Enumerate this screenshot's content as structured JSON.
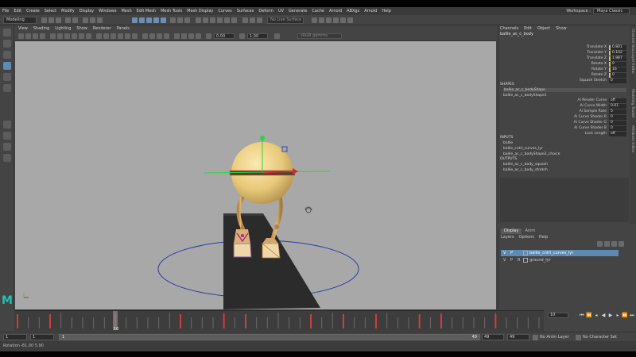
{
  "menubar": {
    "items": [
      "File",
      "Edit",
      "Create",
      "Select",
      "Modify",
      "Display",
      "Windows",
      "Mesh",
      "Edit Mesh",
      "Mesh Tools",
      "Mesh Display",
      "Curves",
      "Surfaces",
      "Deform",
      "UV",
      "Generate",
      "Cache",
      "Arnold",
      "ABXgs",
      "Arnold",
      "Help"
    ],
    "workspace_label": "Workspace :",
    "workspace_value": "Maya Classic"
  },
  "statusline": {
    "mode": "Modeling",
    "live_surface": "No Live Surface"
  },
  "viewport": {
    "menu": [
      "View",
      "Shading",
      "Lighting",
      "Show",
      "Renderer",
      "Panels"
    ],
    "field_a": "0.00",
    "field_b": "1.00",
    "color_space": "sRGB gamma"
  },
  "channel_box": {
    "menu": [
      "Channels",
      "Edit",
      "Object",
      "Show"
    ],
    "object": "ballie_ac_c_body",
    "attrs": [
      {
        "name": "Translate X",
        "value": "0.801"
      },
      {
        "name": "Translate Y",
        "value": "0.102"
      },
      {
        "name": "Translate Z",
        "value": "1.987"
      },
      {
        "name": "Rotate X",
        "value": "0"
      },
      {
        "name": "Rotate Y",
        "value": "16"
      },
      {
        "name": "Rotate Z",
        "value": "0"
      },
      {
        "name": "Squash Stretch",
        "value": "0"
      }
    ],
    "shapes_label": "SHAPES",
    "shapes": [
      "ballie_ac_c_bodyShape",
      "ballie_ac_c_bodyShape1"
    ],
    "shape_attrs": [
      {
        "name": "Ai Render Curve",
        "value": "off"
      },
      {
        "name": "Ai Curve Width",
        "value": "0.01"
      },
      {
        "name": "Ai Sample Rate",
        "value": "5"
      },
      {
        "name": "Ai Curve Shader R",
        "value": "0"
      },
      {
        "name": "Ai Curve Shader G",
        "value": "0"
      },
      {
        "name": "Ai Curve Shader B",
        "value": "0"
      },
      {
        "name": "Lock Length",
        "value": "off"
      }
    ],
    "inputs_label": "INPUTS",
    "inputs": [
      "ballie",
      "ballie_cntrl_curves_lyr",
      "ballie_ac_c_bodyShape2_choice"
    ],
    "outputs_label": "OUTPUTS",
    "outputs": [
      "ballie_ac_c_body_squash",
      "ballie_ac_c_body_stretch"
    ]
  },
  "side_tabs": [
    "Channel Box/Layer Editor",
    "Modeling Toolkit",
    "Attribute Editor"
  ],
  "layers": {
    "tabs": [
      "Display",
      "Anim"
    ],
    "menu": [
      "Layers",
      "Options",
      "Help"
    ],
    "rows": [
      {
        "v": "V",
        "p": "P",
        "r": "",
        "name": "ballie_cntrl_curves_lyr"
      },
      {
        "v": "V",
        "p": "P",
        "r": "R",
        "name": "ground_lyr"
      }
    ]
  },
  "timeline": {
    "current_frame_field": "10",
    "marker_label": "10",
    "keyframes": [
      1,
      4,
      10,
      16,
      20,
      22,
      28,
      31,
      34,
      38,
      40,
      45
    ]
  },
  "range": {
    "start": "1",
    "start_inner": "1",
    "slider_start": "1",
    "slider_end": "49",
    "end_inner": "49",
    "end": "49",
    "anim_layer": "No Anim Layer",
    "char_set": "No Character Set"
  },
  "cmdline": {
    "mel": "Rotation",
    "result": "-81.00   5.90"
  },
  "colors": {
    "viewport_bg": "#a8a8a8",
    "body_yellow": "#e8c97a",
    "ground": "#2b2b2b",
    "selection_blue": "#5b8ab3",
    "maya_teal": "#1ec1b3"
  }
}
